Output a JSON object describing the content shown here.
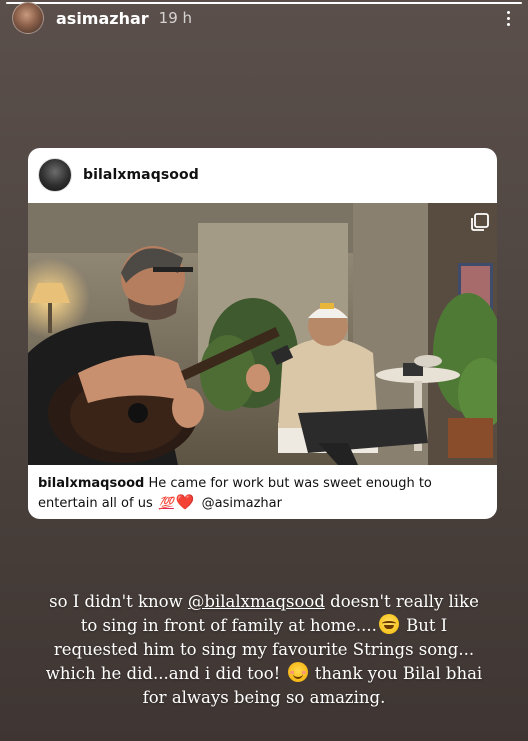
{
  "story": {
    "progress_fraction": 1.0,
    "author": {
      "username": "asimazhar",
      "timestamp": "19 h",
      "avatar_icon": "avatar"
    },
    "menu_icon": "more-vertical-icon"
  },
  "shared_post": {
    "username": "bilalxmaqsood",
    "multi_photo_icon": "carousel-icon",
    "photo_description_icon": "photo",
    "caption": {
      "user": "bilalxmaqsood",
      "text_before": " He came for work but was sweet enough to entertain all of us ",
      "emoji_1": "💯",
      "emoji_2": "❤️",
      "text_after": " @asimazhar"
    }
  },
  "story_text": {
    "line1_before": "so I didn't know ",
    "line1_mention": "@bilalxmaqsood",
    "line1_after": " doesn't really like",
    "line2_before": "to sing in front of family at home....",
    "line2_after": " But I",
    "line3": "requested him to sing my favourite Strings song...",
    "line4_before": "which he did...and i did too! ",
    "line4_after": " thank you Bilal bhai",
    "line5": "for always being so amazing."
  },
  "colors": {
    "background_top": "#5a4f4b",
    "background_bottom": "#3f3633",
    "card": "#ffffff",
    "heart": "#e0245e"
  }
}
